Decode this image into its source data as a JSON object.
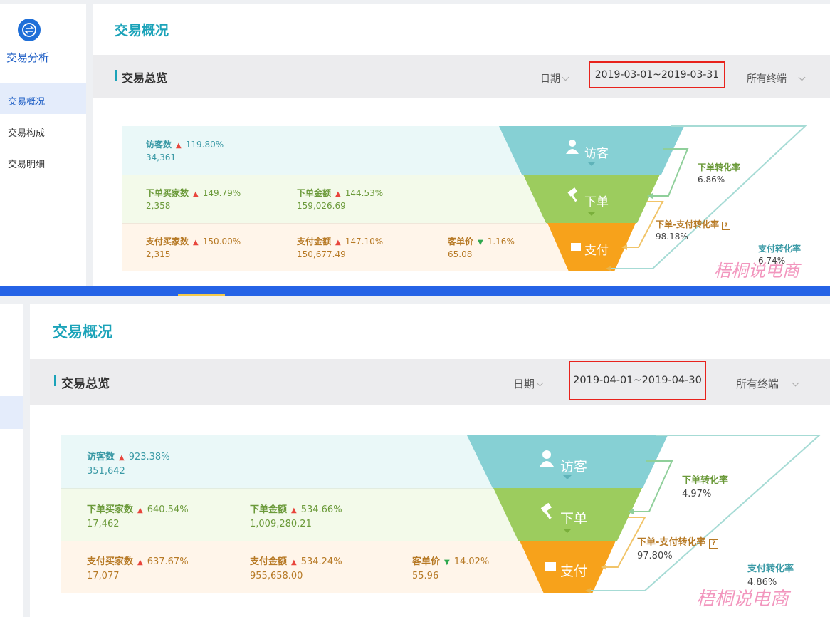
{
  "app": {
    "name": "交易分析",
    "nav": [
      {
        "label": "交易概况",
        "active": true
      },
      {
        "label": "交易构成",
        "active": false
      },
      {
        "label": "交易明细",
        "active": false
      }
    ]
  },
  "colors": {
    "accent": "#1ba3b9",
    "highlight_box": "#e8221c",
    "funnel_visitor": "#86d0d4",
    "funnel_order": "#9ccc5e",
    "funnel_pay": "#f7a21b",
    "divider": "#2563e6"
  },
  "top": {
    "page_title": "交易概况",
    "section_title": "交易总览",
    "date_label": "日期",
    "date_range": "2019-03-01~2019-03-31",
    "terminal": "所有终端",
    "rows": [
      {
        "metrics": [
          {
            "label": "访客数",
            "trend": "up",
            "change": "119.80%",
            "value": "34,361"
          }
        ]
      },
      {
        "metrics": [
          {
            "label": "下单买家数",
            "trend": "up",
            "change": "149.79%",
            "value": "2,358"
          },
          {
            "label": "下单金额",
            "trend": "up",
            "change": "144.53%",
            "value": "159,026.69"
          }
        ]
      },
      {
        "metrics": [
          {
            "label": "支付买家数",
            "trend": "up",
            "change": "150.00%",
            "value": "2,315"
          },
          {
            "label": "支付金额",
            "trend": "up",
            "change": "147.10%",
            "value": "150,677.49"
          },
          {
            "label": "客单价",
            "trend": "down",
            "change": "1.16%",
            "value": "65.08"
          }
        ]
      }
    ],
    "funnel": {
      "stages": [
        "访客",
        "下单",
        "支付"
      ],
      "order_rate_label": "下单转化率",
      "order_rate": "6.86%",
      "order_pay_label": "下单-支付转化率",
      "order_pay": "98.18%",
      "pay_rate_label": "支付转化率",
      "pay_rate": "6.74%"
    }
  },
  "bottom": {
    "page_title": "交易概况",
    "section_title": "交易总览",
    "date_label": "日期",
    "date_range": "2019-04-01~2019-04-30",
    "terminal": "所有终端",
    "rows": [
      {
        "metrics": [
          {
            "label": "访客数",
            "trend": "up",
            "change": "923.38%",
            "value": "351,642"
          }
        ]
      },
      {
        "metrics": [
          {
            "label": "下单买家数",
            "trend": "up",
            "change": "640.54%",
            "value": "17,462"
          },
          {
            "label": "下单金额",
            "trend": "up",
            "change": "534.66%",
            "value": "1,009,280.21"
          }
        ]
      },
      {
        "metrics": [
          {
            "label": "支付买家数",
            "trend": "up",
            "change": "637.67%",
            "value": "17,077"
          },
          {
            "label": "支付金额",
            "trend": "up",
            "change": "534.24%",
            "value": "955,658.00"
          },
          {
            "label": "客单价",
            "trend": "down",
            "change": "14.02%",
            "value": "55.96"
          }
        ]
      }
    ],
    "funnel": {
      "stages": [
        "访客",
        "下单",
        "支付"
      ],
      "order_rate_label": "下单转化率",
      "order_rate": "4.97%",
      "order_pay_label": "下单-支付转化率",
      "order_pay": "97.80%",
      "pay_rate_label": "支付转化率",
      "pay_rate": "4.86%"
    }
  },
  "watermark": "梧桐说电商"
}
